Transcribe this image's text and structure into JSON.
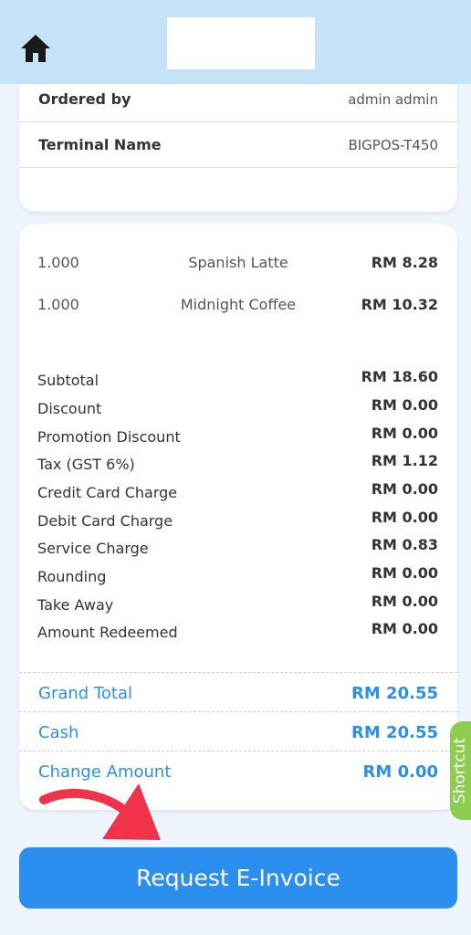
{
  "header": {
    "home_icon": "home-icon"
  },
  "order_info": [
    {
      "label": "Ordered by",
      "value": "admin admin"
    },
    {
      "label": "Terminal Name",
      "value": "BIGPOS-T450"
    }
  ],
  "items": [
    {
      "qty": "1.000",
      "name": "Spanish Latte",
      "price": "RM 8.28"
    },
    {
      "qty": "1.000",
      "name": "Midnight Coffee",
      "price": "RM 10.32"
    }
  ],
  "summary": [
    {
      "label": "Subtotal",
      "value": "RM 18.60"
    },
    {
      "label": "Discount",
      "value": "RM 0.00"
    },
    {
      "label": "Promotion Discount",
      "value": "RM 0.00"
    },
    {
      "label": "Tax (GST 6%)",
      "value": "RM 1.12"
    },
    {
      "label": "Credit Card Charge",
      "value": "RM 0.00"
    },
    {
      "label": "Debit Card Charge",
      "value": "RM 0.00"
    },
    {
      "label": "Service Charge",
      "value": "RM 0.83"
    },
    {
      "label": "Rounding",
      "value": "RM 0.00"
    },
    {
      "label": "Take Away",
      "value": "RM 0.00"
    },
    {
      "label": "Amount Redeemed",
      "value": "RM 0.00"
    }
  ],
  "totals": [
    {
      "label": "Grand Total",
      "value": "RM 20.55"
    },
    {
      "label": "Cash",
      "value": "RM 20.55"
    },
    {
      "label": "Change Amount",
      "value": "RM 0.00"
    }
  ],
  "shortcut_label": "Shortcut",
  "einvoice_button_label": "Request E-Invoice",
  "colors": {
    "header_bg": "#c5e3f7",
    "accent_blue": "#2b8fe6",
    "shortcut_green": "#8ccc4e",
    "arrow_red": "#f0324a"
  }
}
